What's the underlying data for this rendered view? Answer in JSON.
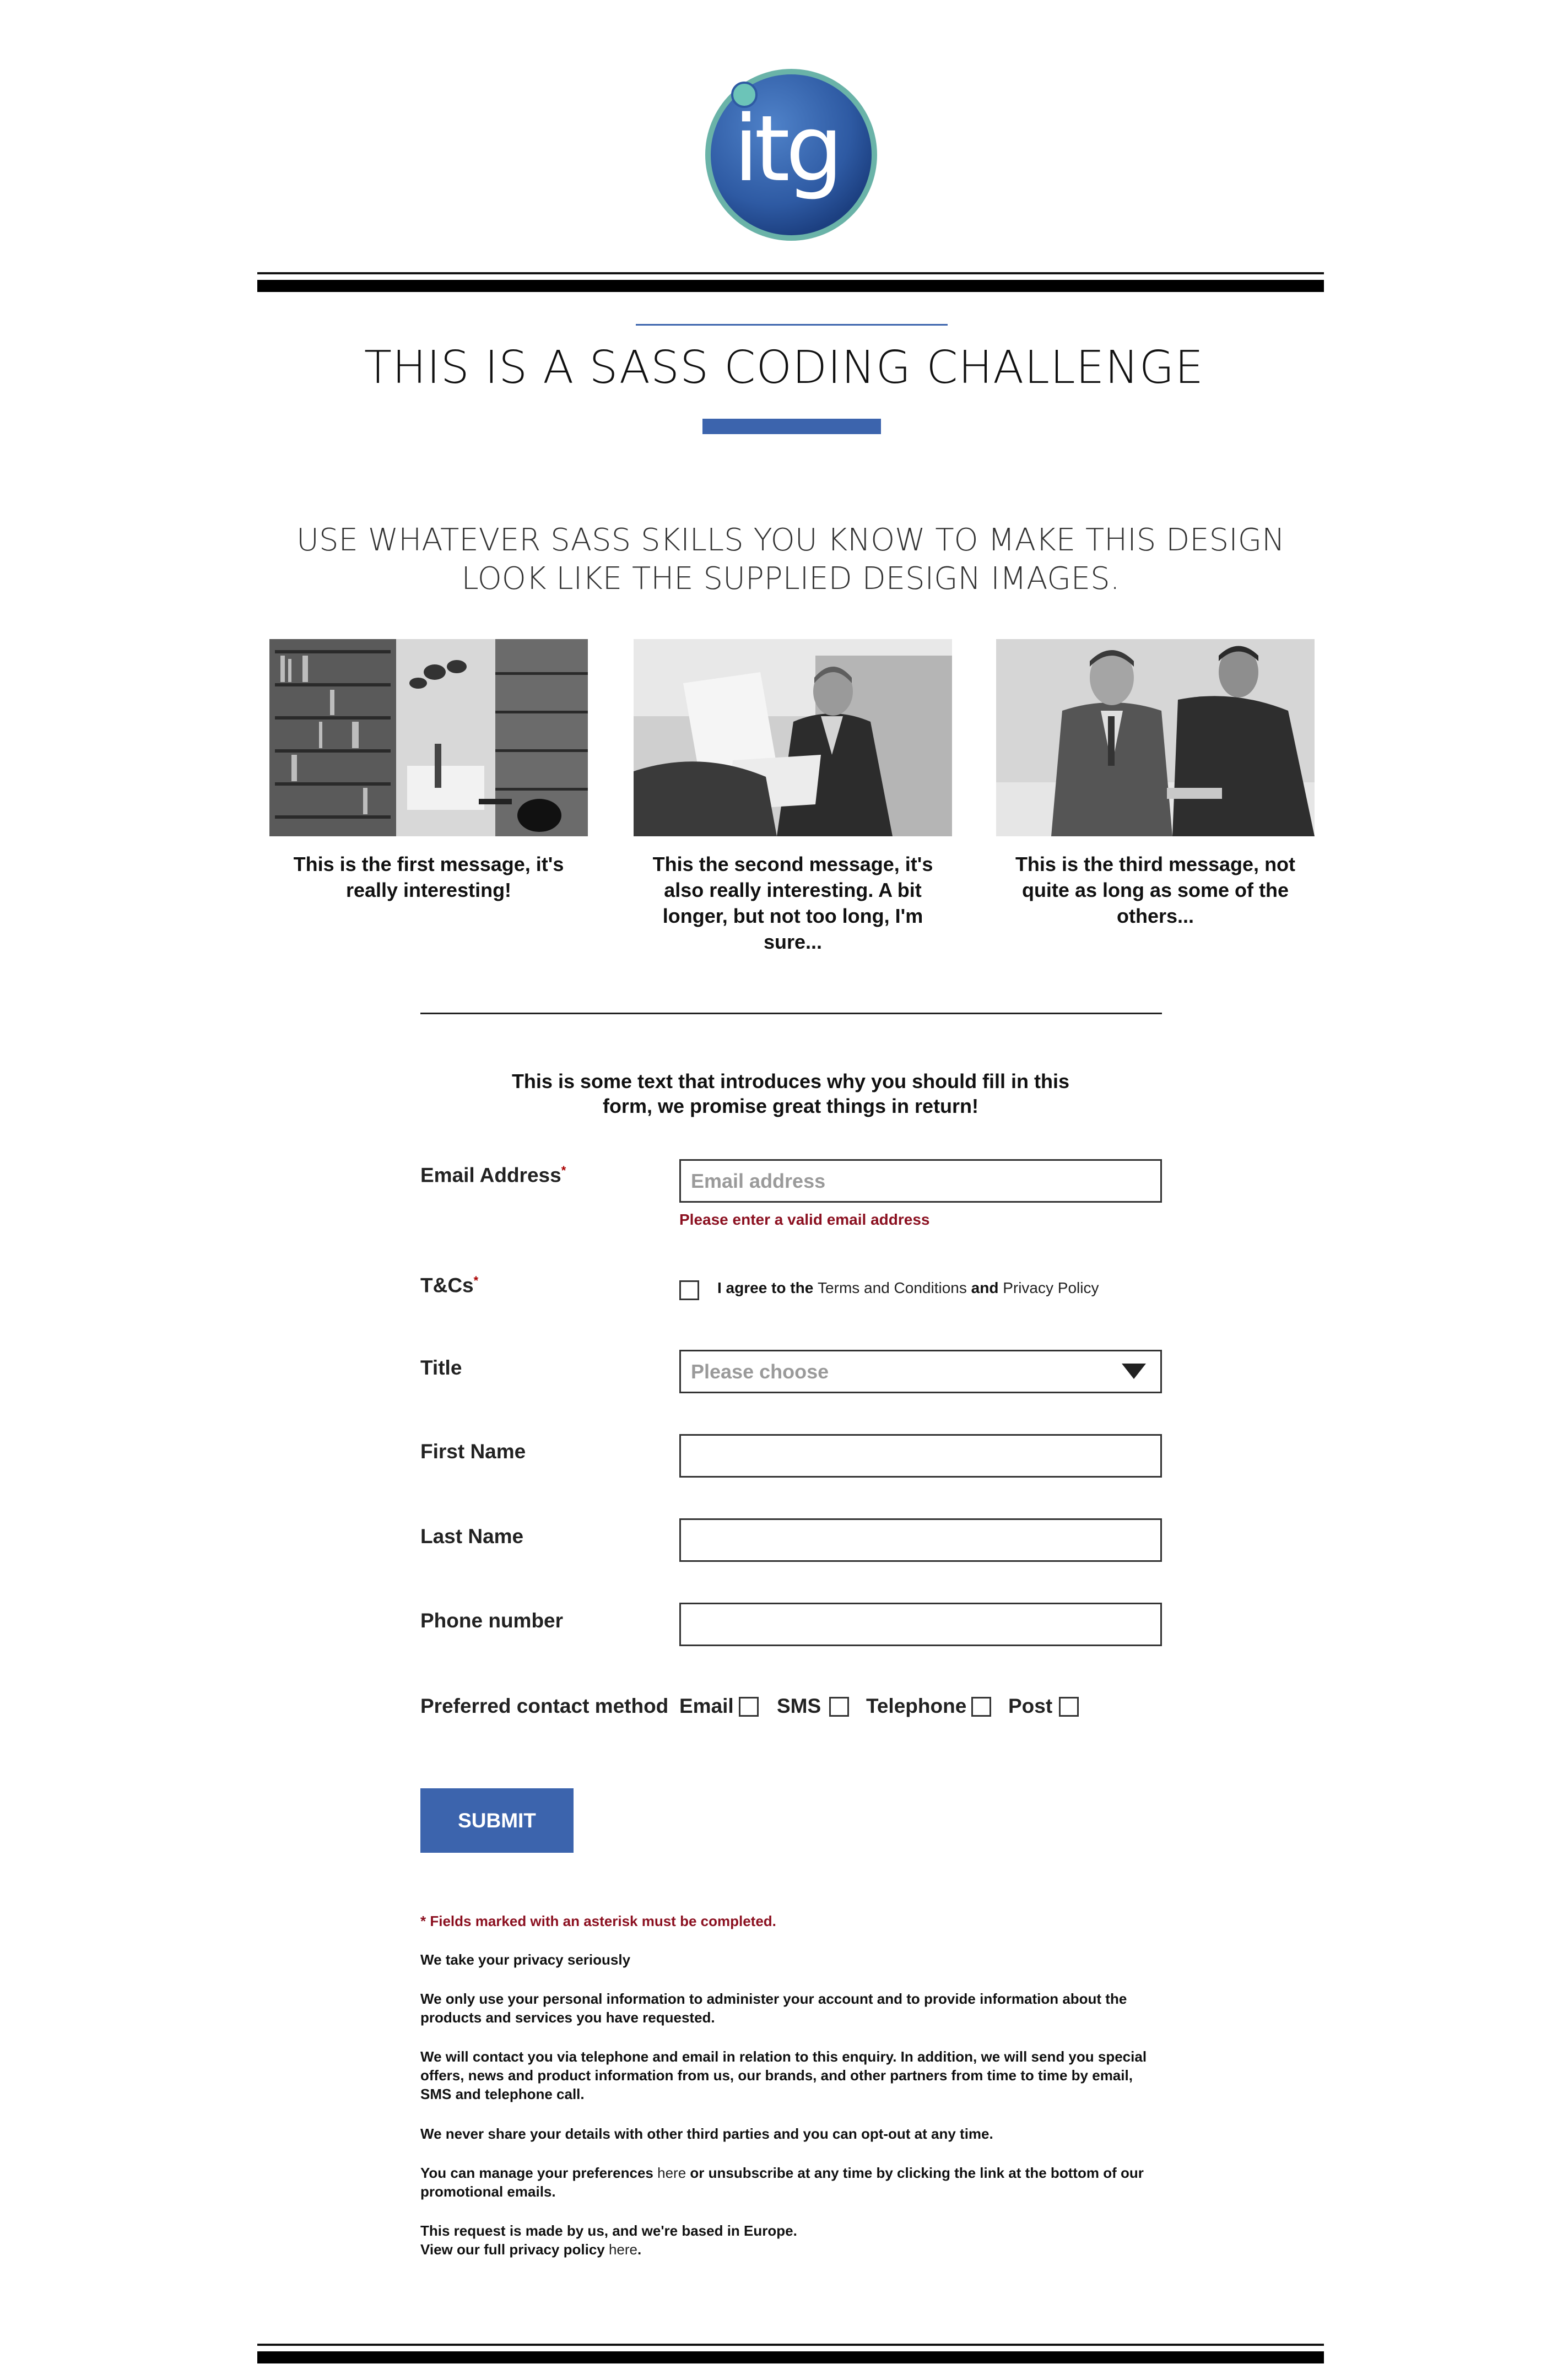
{
  "logo": {
    "text": "itg",
    "colors": {
      "outer": "#6ab3a8",
      "inner": "#2e5aa3",
      "dot": "#6cc4b8"
    }
  },
  "header": {
    "title": "THIS IS A SASS CODING CHALLENGE"
  },
  "subtitle": "USE WHATEVER SASS SKILLS YOU KNOW TO MAKE THIS DESIGN LOOK LIKE THE SUPPLIED DESIGN IMAGES.",
  "cards": [
    {
      "image": "library-interior-photo",
      "message": "This is the first message, it's really interesting!"
    },
    {
      "image": "businessman-reading-photo",
      "message": "This the second message, it's also really interesting. A bit longer, but not too long, I'm sure..."
    },
    {
      "image": "business-meeting-photo",
      "message": "This is the third message, not quite as long as some of the others..."
    }
  ],
  "form": {
    "intro": "This is some text that introduces why you should fill in this form, we promise great things in return!",
    "email": {
      "label": "Email Address",
      "required_mark": "*",
      "placeholder": "Email address",
      "error": "Please enter a valid email address"
    },
    "tcs": {
      "label": "T&Cs",
      "required_mark": "*",
      "text_before": "I agree to the ",
      "terms_link": "Terms and Conditions",
      "text_and": " and ",
      "privacy_link": "Privacy Policy",
      "checked": false
    },
    "title": {
      "label": "Title",
      "selected": "Please choose"
    },
    "first_name": {
      "label": "First Name",
      "value": ""
    },
    "last_name": {
      "label": "Last Name",
      "value": ""
    },
    "phone": {
      "label": "Phone number",
      "value": ""
    },
    "contact": {
      "label": "Preferred contact method",
      "options": [
        "Email",
        "SMS",
        "Telephone",
        "Post"
      ]
    },
    "submit": "SUBMIT"
  },
  "footer": {
    "required_note_mark": "*",
    "required_note": " Fields marked with an asterisk must be completed.",
    "privacy_heading": "We take your privacy seriously",
    "p1": "We only use your personal information to administer your account and to provide information about the products and services you have requested.",
    "p2": "We will contact you via telephone and email in relation to this enquiry. In addition, we will send you special offers, news and product information from us, our brands, and other partners from time to time by email, SMS and telephone call.",
    "p3": "We never share your details with other third parties and you can opt-out at any time.",
    "p4_before": "You can manage your preferences ",
    "p4_link": "here",
    "p4_after": " or unsubscribe at any time by clicking the link at the bottom of our promotional emails.",
    "p5_line1": "This request is made by us, and we're based in Europe.",
    "p5_line2_before": "View our full privacy policy ",
    "p5_link": "here",
    "p5_line2_after": "."
  },
  "colors": {
    "accent": "#3c64ad",
    "error": "#8b1020",
    "rule": "#000000"
  }
}
